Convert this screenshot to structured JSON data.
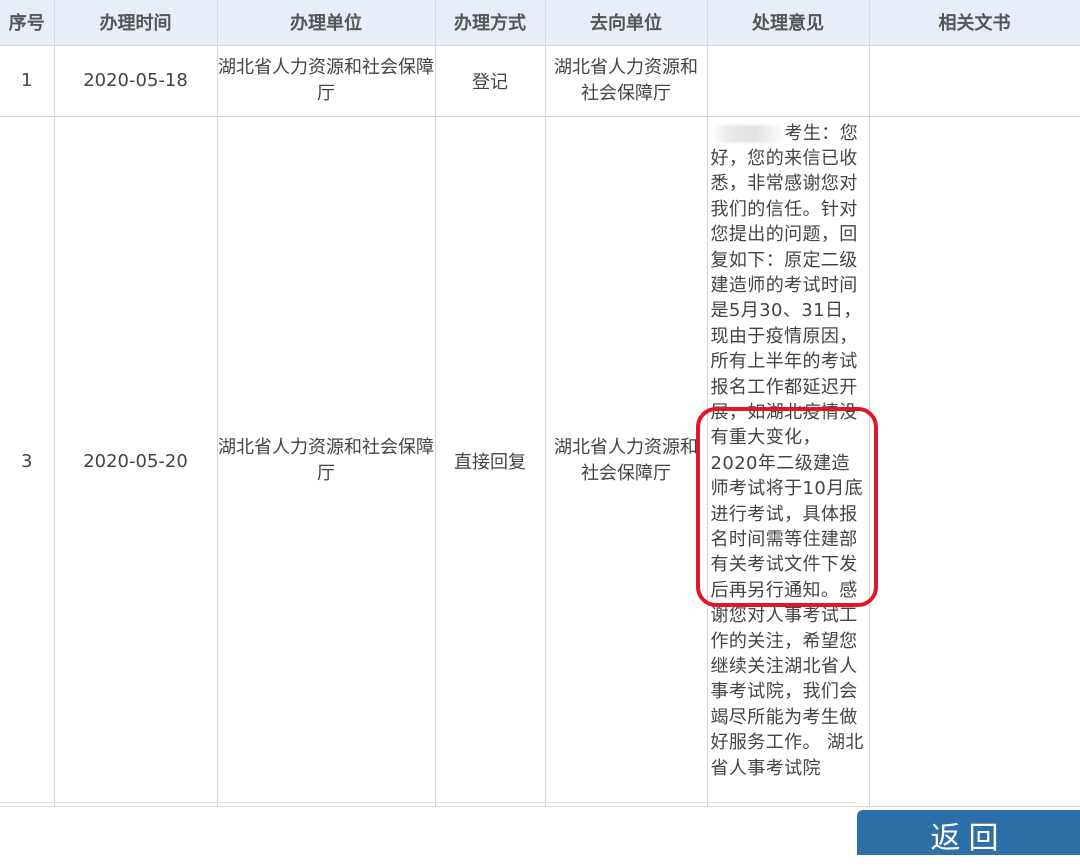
{
  "table": {
    "headers": [
      "序号",
      "办理时间",
      "办理单位",
      "办理方式",
      "去向单位",
      "处理意见",
      "相关文书"
    ],
    "rows": [
      {
        "index": "1",
        "date": "2020-05-18",
        "unit": "湖北省人力资源和社会保障厅",
        "method": "登记",
        "destination": "湖北省人力资源和\n社会保障厅",
        "opinion": "",
        "documents": ""
      },
      {
        "index": "3",
        "date": "2020-05-20",
        "unit": "湖北省人力资源和社会保障厅",
        "method": "直接回复",
        "destination": "湖北省人力资源和\n社会保障厅",
        "opinion_lead": "考生：您好，您的来信已收悉，非常感谢您对我们的信任。针对您提出的问题，回复如下：原定二级建造师的考试时间是5月30、31日，现由于疫情原因，所有上半年的考试报名工作都延迟开展，如湖北疫情没有重大变化，2020年二级建造师考试将于10月底进行考试，具体报名时间需等住建部有关考试文件下发后再另行通知。感谢您对人事考试工作的关注，希望您继续关注湖北省人事考试院，我们会竭尽所能为考生做好服务工作。 湖北省人事考试院",
        "documents": ""
      }
    ]
  },
  "buttons": {
    "back_label": "返回"
  },
  "colors": {
    "header_bg": "#e6eef7",
    "highlight": "#e0172a",
    "button_bg": "#2f6fa8"
  }
}
